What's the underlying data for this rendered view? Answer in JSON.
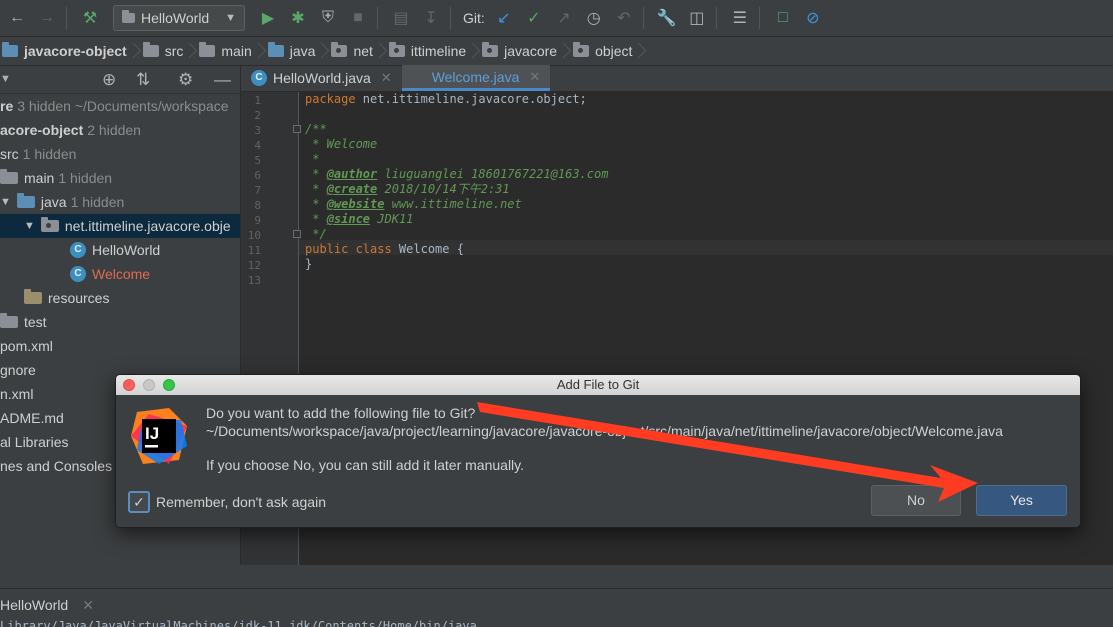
{
  "toolbar": {
    "run_config": "HelloWorld",
    "git_label": "Git:"
  },
  "breadcrumb": [
    "javacore-object",
    "src",
    "main",
    "java",
    "net",
    "ittimeline",
    "javacore",
    "object"
  ],
  "project": {
    "rows": [
      {
        "name": "re",
        "hint": "3 hidden  ~/Documents/workspace"
      },
      {
        "name": "acore-object",
        "hint": "2 hidden"
      },
      {
        "name": "src",
        "hint": "1 hidden"
      },
      {
        "name": "main",
        "hint": "1 hidden"
      },
      {
        "name": "java",
        "hint": "1 hidden"
      },
      {
        "name": "net.ittimeline.javacore.obje",
        "hint": ""
      },
      {
        "name": "HelloWorld",
        "hint": ""
      },
      {
        "name": "Welcome",
        "hint": ""
      },
      {
        "name": "resources",
        "hint": ""
      },
      {
        "name": "test",
        "hint": ""
      },
      {
        "name": "pom.xml",
        "hint": ""
      },
      {
        "name": "gnore",
        "hint": ""
      },
      {
        "name": "n.xml",
        "hint": ""
      },
      {
        "name": "ADME.md",
        "hint": ""
      },
      {
        "name": "al Libraries",
        "hint": ""
      },
      {
        "name": "nes and Consoles",
        "hint": ""
      }
    ]
  },
  "tabs": [
    {
      "label": "HelloWorld.java"
    },
    {
      "label": "Welcome.java"
    }
  ],
  "editor": {
    "line_numbers": [
      "1",
      "2",
      "3",
      "4",
      "5",
      "6",
      "7",
      "8",
      "9",
      "10",
      "11",
      "12",
      "13"
    ],
    "package_kw": "package",
    "package_name": " net.ittimeline.javacore.object;",
    "doc_open": "/**",
    "doc_title": " * Welcome",
    "doc_blank": " *",
    "author_tag": "@author",
    "author_val": " liuguanglei 18601767221@163.com",
    "create_tag": "@create",
    "create_val": " 2018/10/14下午2:31",
    "website_tag": "@website",
    "website_val": " www.ittimeline.net",
    "since_tag": "@since",
    "since_val": " JDK11",
    "doc_close": " */",
    "class_kw": "public class",
    "class_name": " Welcome {",
    "close_brace": "}"
  },
  "dialog": {
    "title": "Add File to Git",
    "question": "Do you want to add the following file to Git?",
    "path": "~/Documents/workspace/java/project/learning/javacore/javacore-object/src/main/java/net/ittimeline/javacore/object/Welcome.java",
    "note": "If you choose No, you can still add it later manually.",
    "remember": "Remember, don't ask again",
    "no": "No",
    "yes": "Yes",
    "logo_text": "IJ"
  },
  "run": {
    "tab_label": "HelloWorld",
    "command": "Library/Java/JavaVirtualMachines/jdk-11.jdk/Contents/Home/bin/java ..."
  },
  "colors": {
    "accent": "#4a88c7",
    "annotation_arrow": "#ff3b22"
  }
}
